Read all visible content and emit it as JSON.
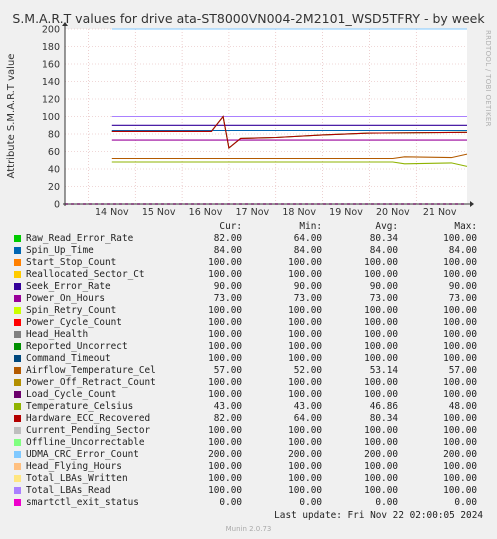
{
  "title": "S.M.A.R.T values for drive ata-ST8000VN004-2M2101_WSD5TFRY - by week",
  "side_text": "RRDTOOL / TOBI OETIKER",
  "headers": {
    "cur": "Cur:",
    "min": "Min:",
    "avg": "Avg:",
    "max": "Max:"
  },
  "legend": [
    {
      "name": "Raw_Read_Error_Rate",
      "color": "#00cc00",
      "cur": "82.00",
      "min": "64.00",
      "avg": "80.34",
      "max": "100.00"
    },
    {
      "name": "Spin_Up_Time",
      "color": "#0066b3",
      "cur": "84.00",
      "min": "84.00",
      "avg": "84.00",
      "max": "84.00"
    },
    {
      "name": "Start_Stop_Count",
      "color": "#ff8000",
      "cur": "100.00",
      "min": "100.00",
      "avg": "100.00",
      "max": "100.00"
    },
    {
      "name": "Reallocated_Sector_Ct",
      "color": "#ffcc00",
      "cur": "100.00",
      "min": "100.00",
      "avg": "100.00",
      "max": "100.00"
    },
    {
      "name": "Seek_Error_Rate",
      "color": "#330099",
      "cur": "90.00",
      "min": "90.00",
      "avg": "90.00",
      "max": "90.00"
    },
    {
      "name": "Power_On_Hours",
      "color": "#990099",
      "cur": "73.00",
      "min": "73.00",
      "avg": "73.00",
      "max": "73.00"
    },
    {
      "name": "Spin_Retry_Count",
      "color": "#ccff00",
      "cur": "100.00",
      "min": "100.00",
      "avg": "100.00",
      "max": "100.00"
    },
    {
      "name": "Power_Cycle_Count",
      "color": "#ff0000",
      "cur": "100.00",
      "min": "100.00",
      "avg": "100.00",
      "max": "100.00"
    },
    {
      "name": "Head_Health",
      "color": "#808080",
      "cur": "100.00",
      "min": "100.00",
      "avg": "100.00",
      "max": "100.00"
    },
    {
      "name": "Reported_Uncorrect",
      "color": "#008f00",
      "cur": "100.00",
      "min": "100.00",
      "avg": "100.00",
      "max": "100.00"
    },
    {
      "name": "Command_Timeout",
      "color": "#00487d",
      "cur": "100.00",
      "min": "100.00",
      "avg": "100.00",
      "max": "100.00"
    },
    {
      "name": "Airflow_Temperature_Cel",
      "color": "#b35a00",
      "cur": "57.00",
      "min": "52.00",
      "avg": "53.14",
      "max": "57.00"
    },
    {
      "name": "Power_Off_Retract_Count",
      "color": "#b38f00",
      "cur": "100.00",
      "min": "100.00",
      "avg": "100.00",
      "max": "100.00"
    },
    {
      "name": "Load_Cycle_Count",
      "color": "#6b006b",
      "cur": "100.00",
      "min": "100.00",
      "avg": "100.00",
      "max": "100.00"
    },
    {
      "name": "Temperature_Celsius",
      "color": "#8fb300",
      "cur": "43.00",
      "min": "43.00",
      "avg": "46.86",
      "max": "48.00"
    },
    {
      "name": "Hardware_ECC_Recovered",
      "color": "#b30000",
      "cur": "82.00",
      "min": "64.00",
      "avg": "80.34",
      "max": "100.00"
    },
    {
      "name": "Current_Pending_Sector",
      "color": "#bebebe",
      "cur": "100.00",
      "min": "100.00",
      "avg": "100.00",
      "max": "100.00"
    },
    {
      "name": "Offline_Uncorrectable",
      "color": "#80ff80",
      "cur": "100.00",
      "min": "100.00",
      "avg": "100.00",
      "max": "100.00"
    },
    {
      "name": "UDMA_CRC_Error_Count",
      "color": "#80c9ff",
      "cur": "200.00",
      "min": "200.00",
      "avg": "200.00",
      "max": "200.00"
    },
    {
      "name": "Head_Flying_Hours",
      "color": "#ffc080",
      "cur": "100.00",
      "min": "100.00",
      "avg": "100.00",
      "max": "100.00"
    },
    {
      "name": "Total_LBAs_Written",
      "color": "#ffe680",
      "cur": "100.00",
      "min": "100.00",
      "avg": "100.00",
      "max": "100.00"
    },
    {
      "name": "Total_LBAs_Read",
      "color": "#aa80ff",
      "cur": "100.00",
      "min": "100.00",
      "avg": "100.00",
      "max": "100.00"
    },
    {
      "name": "smartctl_exit_status",
      "color": "#ee00cc",
      "cur": "0.00",
      "min": "0.00",
      "avg": "0.00",
      "max": "0.00"
    }
  ],
  "last_update": "Last update: Fri Nov 22 02:00:05 2024",
  "munin_version": "Munin 2.0.73",
  "chart_data": {
    "type": "line",
    "title": "S.M.A.R.T values for drive ata-ST8000VN004-2M2101_WSD5TFRY - by week",
    "ylabel": "Attribute S.M.A.R.T value",
    "xlabel": "",
    "ylim": [
      0,
      200
    ],
    "yticks": [
      0,
      20,
      40,
      60,
      80,
      100,
      120,
      140,
      160,
      180,
      200
    ],
    "xlim": [
      "Nov 13 12:00",
      "Nov 22 02:00"
    ],
    "xticks": [
      {
        "label": "14 Nov",
        "day": 14
      },
      {
        "label": "15 Nov",
        "day": 15
      },
      {
        "label": "16 Nov",
        "day": 16
      },
      {
        "label": "17 Nov",
        "day": 17
      },
      {
        "label": "18 Nov",
        "day": 18
      },
      {
        "label": "19 Nov",
        "day": 19
      },
      {
        "label": "20 Nov",
        "day": 20
      },
      {
        "label": "21 Nov",
        "day": 21
      }
    ],
    "data_start": "Nov 14 12:00",
    "series": [
      {
        "name": "Raw_Read_Error_Rate",
        "points": [
          [
            "Nov 14 12:00",
            83
          ],
          [
            "Nov 16 15:00",
            83
          ],
          [
            "Nov 16 21:00",
            100
          ],
          [
            "Nov 17 00:00",
            64
          ],
          [
            "Nov 17 06:00",
            75
          ],
          [
            "Nov 18 00:00",
            76
          ],
          [
            "Nov 19 00:00",
            79
          ],
          [
            "Nov 20 00:00",
            81
          ],
          [
            "Nov 22 02:00",
            82
          ]
        ]
      },
      {
        "name": "Spin_Up_Time",
        "points": [
          [
            "Nov 14 12:00",
            84
          ],
          [
            "Nov 22 02:00",
            84
          ]
        ]
      },
      {
        "name": "Seek_Error_Rate",
        "points": [
          [
            "Nov 14 12:00",
            90
          ],
          [
            "Nov 22 02:00",
            90
          ]
        ]
      },
      {
        "name": "Power_On_Hours",
        "points": [
          [
            "Nov 14 12:00",
            73
          ],
          [
            "Nov 22 02:00",
            73
          ]
        ]
      },
      {
        "name": "Airflow_Temperature_Cel",
        "points": [
          [
            "Nov 14 12:00",
            52
          ],
          [
            "Nov 20 12:00",
            52
          ],
          [
            "Nov 20 18:00",
            54
          ],
          [
            "Nov 21 18:00",
            53
          ],
          [
            "Nov 22 02:00",
            57
          ]
        ]
      },
      {
        "name": "Temperature_Celsius",
        "points": [
          [
            "Nov 14 12:00",
            48
          ],
          [
            "Nov 20 12:00",
            48
          ],
          [
            "Nov 20 18:00",
            46
          ],
          [
            "Nov 21 18:00",
            47
          ],
          [
            "Nov 22 02:00",
            43
          ]
        ]
      },
      {
        "name": "Hardware_ECC_Recovered",
        "points": [
          [
            "Nov 14 12:00",
            83
          ],
          [
            "Nov 16 15:00",
            83
          ],
          [
            "Nov 16 21:00",
            100
          ],
          [
            "Nov 17 00:00",
            64
          ],
          [
            "Nov 17 06:00",
            75
          ],
          [
            "Nov 18 00:00",
            76
          ],
          [
            "Nov 19 00:00",
            79
          ],
          [
            "Nov 20 00:00",
            81
          ],
          [
            "Nov 22 02:00",
            82
          ]
        ]
      },
      {
        "name": "smartctl_exit_status",
        "points": [
          [
            "Nov 13 12:00",
            0
          ],
          [
            "Nov 22 02:00",
            0
          ]
        ]
      }
    ],
    "grid": true
  }
}
